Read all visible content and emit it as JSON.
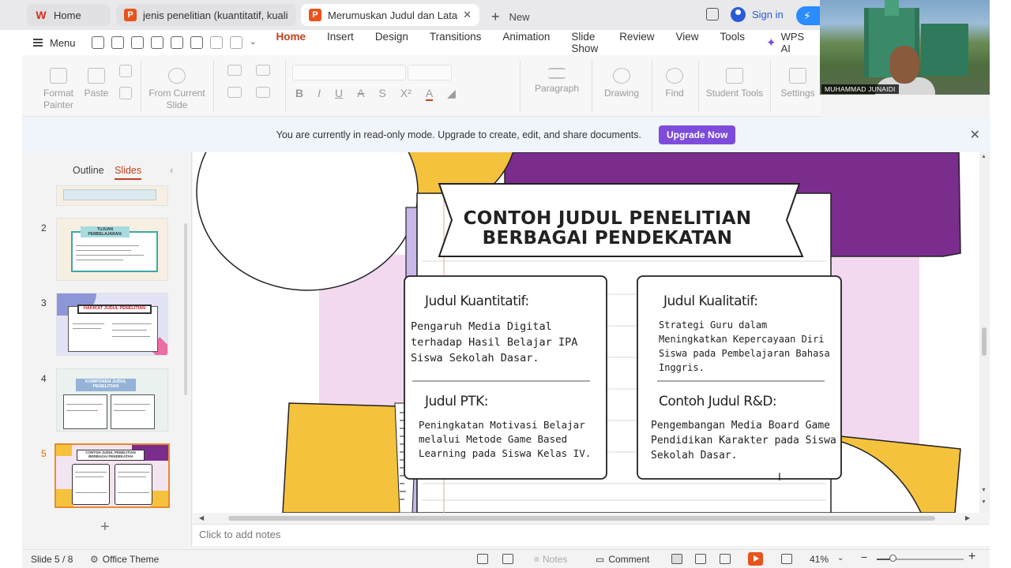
{
  "tabs": {
    "home": "Home",
    "tab1": "jenis penelitian (kuantitatif, kualit",
    "tab2": "Merumuskan Judul dan Latar",
    "new_tab": "New",
    "sign_in": "Sign in"
  },
  "menu": {
    "menu_label": "Menu",
    "ribbon_tabs": [
      "Home",
      "Insert",
      "Design",
      "Transitions",
      "Animation",
      "Slide Show",
      "Review",
      "View",
      "Tools"
    ],
    "wps_ai": "WPS AI"
  },
  "ribbon": {
    "format_painter": "Format Painter",
    "paste": "Paste",
    "from_current_slide": "From Current Slide",
    "paragraph": "Paragraph",
    "drawing": "Drawing",
    "find": "Find",
    "student_tools": "Student Tools",
    "settings": "Settings"
  },
  "webcam": {
    "name": "MUHAMMAD JUNAIDI"
  },
  "banner": {
    "message": "You are currently in read-only mode. Upgrade to create, edit, and share documents.",
    "upgrade_label": "Upgrade Now"
  },
  "panel": {
    "outline": "Outline",
    "slides": "Slides",
    "slide_numbers": [
      "2",
      "3",
      "4",
      "5"
    ],
    "thumb2_title": "TUJUAN PEMBELAJARAN:",
    "thumb3_title": "HAKIKAT JUDUL PENELITIAN",
    "thumb4_title": "KOMPONEN JUDUL PENELITIAN",
    "thumb5_title": "CONTOH JUDUL PENELITIAN BERBAGAI PENDEKATAN"
  },
  "slide": {
    "title_line1": "CONTOH JUDUL PENELITIAN",
    "title_line2": "BERBAGAI PENDEKATAN",
    "card1_heading": "Judul Kuantitatif:",
    "card1_body": "Pengaruh Media Digital terhadap Hasil Belajar IPA Siswa Sekolah Dasar.",
    "card2_heading": "Judul PTK:",
    "card2_body": "Peningkatan Motivasi Belajar melalui Metode Game Based Learning pada Siswa Kelas IV.",
    "card3_heading": "Judul Kualitatif:",
    "card3_body": "Strategi Guru dalam Meningkatkan Kepercayaan Diri Siswa pada Pembelajaran Bahasa Inggris.",
    "card4_heading": "Contoh Judul R&D:",
    "card4_body": "Pengembangan Media Board Game Pendidikan Karakter pada Siswa Sekolah Dasar."
  },
  "notes": {
    "placeholder": "Click to add notes"
  },
  "status": {
    "slide_counter": "Slide 5 / 8",
    "theme": "Office Theme",
    "notes": "Notes",
    "comment": "Comment",
    "zoom": "41%"
  },
  "colors": {
    "accent": "#c43e1c",
    "upgrade": "#7d4cdb",
    "slide_purple": "#7b2d8e",
    "slide_yellow": "#f5c23e",
    "slide_pink": "#f3d9ef"
  },
  "icons": [
    "wps-logo-icon",
    "presentation-icon",
    "close-icon",
    "plus-icon",
    "user-icon",
    "bolt-icon",
    "hamburger-icon",
    "search-icon",
    "ai-star-icon",
    "play-icon"
  ]
}
